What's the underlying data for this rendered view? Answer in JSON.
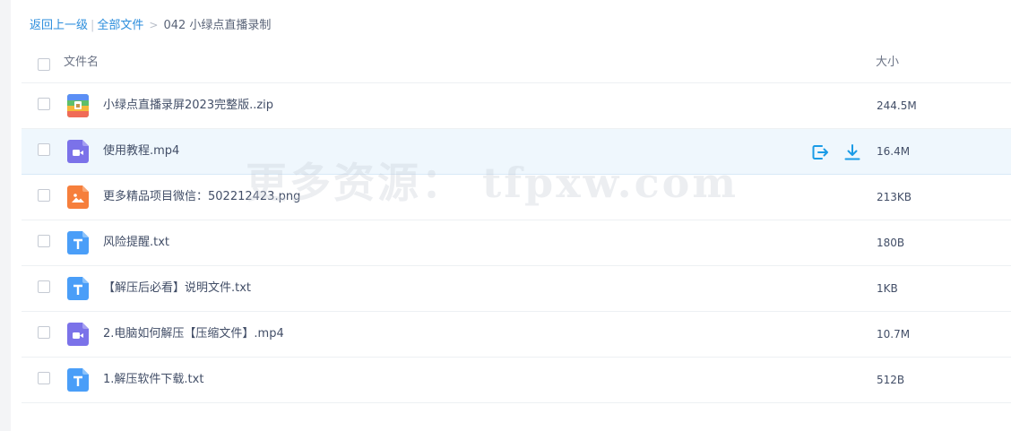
{
  "breadcrumb": {
    "back": "返回上一级",
    "divider": "|",
    "all_files": "全部文件",
    "chevron": ">",
    "current": "042 小绿点直播录制"
  },
  "table": {
    "columns": {
      "name": "文件名",
      "size": "大小"
    }
  },
  "files": [
    {
      "name": "小绿点直播录屏2023完整版..zip",
      "size": "244.5M",
      "icon": "zip-archive-icon"
    },
    {
      "name": "使用教程.mp4",
      "size": "16.4M",
      "icon": "video-file-icon"
    },
    {
      "name": "更多精品项目微信：502212423.png",
      "size": "213KB",
      "icon": "image-file-icon"
    },
    {
      "name": "风险提醒.txt",
      "size": "180B",
      "icon": "text-file-icon"
    },
    {
      "name": "【解压后必看】说明文件.txt",
      "size": "1KB",
      "icon": "text-file-icon"
    },
    {
      "name": "2.电脑如何解压【压缩文件】.mp4",
      "size": "10.7M",
      "icon": "video-file-icon"
    },
    {
      "name": "1.解压软件下载.txt",
      "size": "512B",
      "icon": "text-file-icon"
    }
  ],
  "watermark": "更多资源： tfpxw.com",
  "colors": {
    "link": "#2b8ddc",
    "hover_row": "#eff7fd",
    "action": "#1a9be6",
    "video_icon": "#7b72e9",
    "image_icon": "#f67f3c",
    "text_icon": "#4a9ef8"
  }
}
